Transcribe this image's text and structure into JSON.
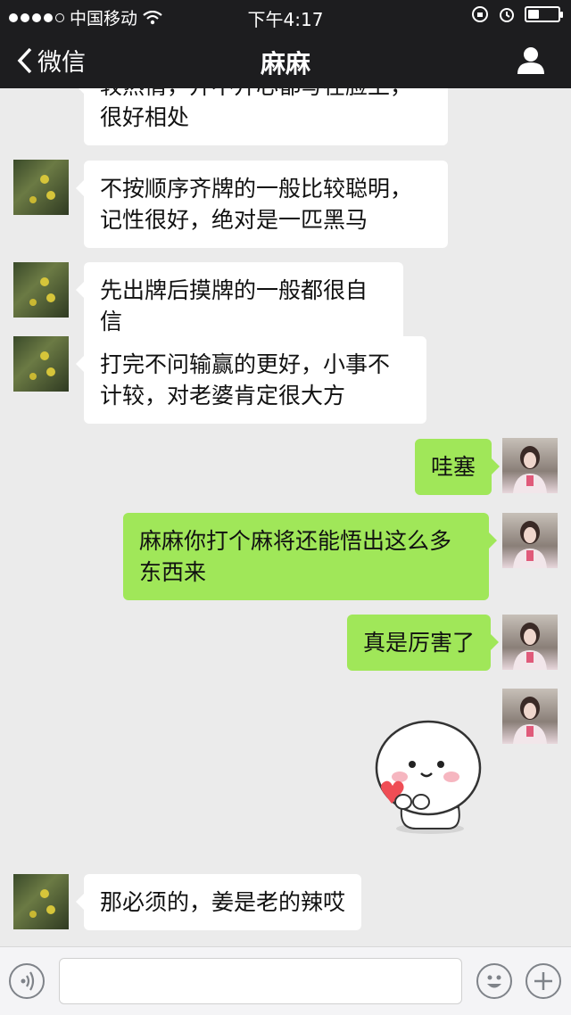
{
  "status_bar": {
    "carrier": "中国移动",
    "time": "下午4:17"
  },
  "nav": {
    "back_label": "微信",
    "title": "麻麻"
  },
  "messages": [
    {
      "sender": "mom",
      "text": "较热情，开不开心都写在脸上，很好相处"
    },
    {
      "sender": "mom",
      "text": "不按顺序齐牌的一般比较聪明，记性很好，绝对是一匹黑马"
    },
    {
      "sender": "mom",
      "text": "先出牌后摸牌的一般都很自信"
    },
    {
      "sender": "mom",
      "text": "打完不问输赢的更好，小事不计较，对老婆肯定很大方"
    },
    {
      "sender": "me",
      "text": "哇塞"
    },
    {
      "sender": "me",
      "text": "麻麻你打个麻将还能悟出这么多东西来"
    },
    {
      "sender": "me",
      "text": "真是厉害了"
    },
    {
      "sender": "me",
      "sticker": "heart-mochi-sticker"
    },
    {
      "sender": "mom",
      "text": "那必须的，姜是老的辣哎"
    }
  ],
  "input_bar": {
    "voice_icon": "voice-icon",
    "emoji_icon": "emoji-icon",
    "plus_icon": "plus-icon"
  },
  "colors": {
    "nav_bg": "#1d1d1f",
    "chat_bg": "#ebebeb",
    "bubble_me": "#a0e759",
    "bubble_other": "#ffffff"
  }
}
